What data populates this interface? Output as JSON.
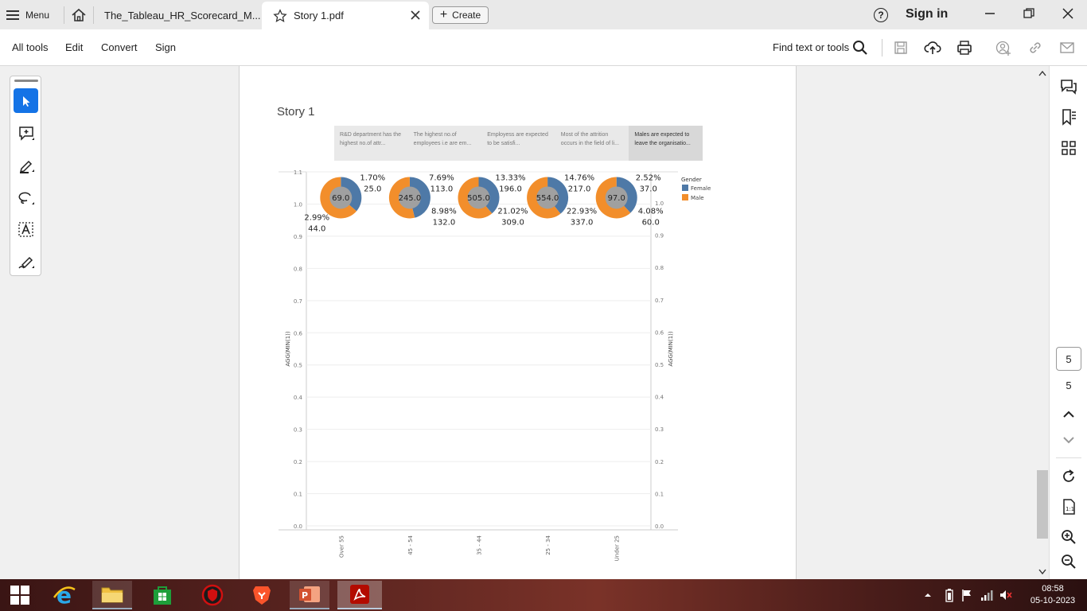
{
  "titlebar": {
    "menu_label": "Menu",
    "tabs": [
      {
        "label": "The_Tableau_HR_Scorecard_M..."
      },
      {
        "label": "Story 1.pdf"
      }
    ],
    "create_label": "Create",
    "help_glyph": "?",
    "signin_label": "Sign in"
  },
  "toolbar": {
    "menus": [
      "All tools",
      "Edit",
      "Convert",
      "Sign"
    ],
    "find_label": "Find text or tools"
  },
  "rightrail": {
    "current_page": "5",
    "total_pages": "5"
  },
  "document": {
    "story_title": "Story 1",
    "story_points": [
      "R&D department has the highest no.of attr...",
      "The highest no.of employees i.e are em...",
      "Employess are expected to be satisfi...",
      "Most of the attrition occurs in the field of li...",
      "Males  are expected to leave the organisatio..."
    ],
    "selected_story_point": 4
  },
  "chart_data": {
    "type": "pie",
    "layout": "pie charts (donut style) placed along a categorical x-axis",
    "categories": [
      "Over 55",
      "45 - 54",
      "35 - 44",
      "25 - 34",
      "Under 25"
    ],
    "ylabel": "AGG(MIN(1))",
    "ylabel_right": "AGG(MIN(1))",
    "ylim": [
      0.0,
      1.1
    ],
    "yticks_left": [
      "0.0",
      "0.1",
      "0.2",
      "0.3",
      "0.4",
      "0.5",
      "0.6",
      "0.7",
      "0.8",
      "0.9",
      "1.0",
      "1.1"
    ],
    "ylim_right": [
      0.0,
      1.0
    ],
    "yticks_right": [
      "0.0",
      "0.1",
      "0.2",
      "0.3",
      "0.4",
      "0.5",
      "0.6",
      "0.7",
      "0.8",
      "0.9",
      "1.0"
    ],
    "pie_y": 1.0,
    "grid": true,
    "legend": {
      "title": "Gender",
      "placement": "top-right",
      "items": [
        {
          "name": "Female",
          "color": "#4e79a7"
        },
        {
          "name": "Male",
          "color": "#f28e2b"
        }
      ]
    },
    "center_color": "#a0a0a0",
    "pies": [
      {
        "category": "Over 55",
        "total": "69.0",
        "female": {
          "value": 25,
          "pct": "1.70%",
          "label": "25.0"
        },
        "male": {
          "value": 44,
          "pct": "2.99%",
          "label": "44.0"
        }
      },
      {
        "category": "45 - 54",
        "total": "245.0",
        "female": {
          "value": 113,
          "pct": "7.69%",
          "label": "113.0"
        },
        "male": {
          "value": 132,
          "pct": "8.98%",
          "label": "132.0"
        }
      },
      {
        "category": "35 - 44",
        "total": "505.0",
        "female": {
          "value": 196,
          "pct": "13.33%",
          "label": "196.0"
        },
        "male": {
          "value": 309,
          "pct": "21.02%",
          "label": "309.0"
        }
      },
      {
        "category": "25 - 34",
        "total": "554.0",
        "female": {
          "value": 217,
          "pct": "14.76%",
          "label": "217.0"
        },
        "male": {
          "value": 337,
          "pct": "22.93%",
          "label": "337.0"
        }
      },
      {
        "category": "Under 25",
        "total": "97.0",
        "female": {
          "value": 37,
          "pct": "2.52%",
          "label": "37.0"
        },
        "male": {
          "value": 60,
          "pct": "4.08%",
          "label": "60.0"
        }
      }
    ]
  },
  "taskbar": {
    "time": "08:58",
    "date": "05-10-2023"
  }
}
